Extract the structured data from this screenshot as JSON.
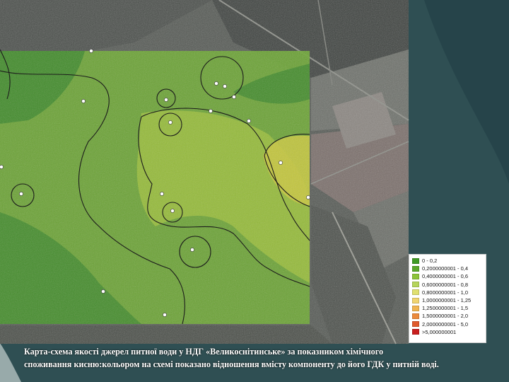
{
  "legend": {
    "items": [
      {
        "label": "0 - 0,2",
        "color": "#3f9a25"
      },
      {
        "label": "0,2000000001 - 0,4",
        "color": "#5aa82a"
      },
      {
        "label": "0,4000000001 - 0,6",
        "color": "#8cc43a"
      },
      {
        "label": "0,6000000001 - 0,8",
        "color": "#b6d55a"
      },
      {
        "label": "0,8000000001 - 1,0",
        "color": "#e0e070"
      },
      {
        "label": "1,0000000001 - 1,25",
        "color": "#f0d470"
      },
      {
        "label": "1,2500000001 - 1,5",
        "color": "#f0b450"
      },
      {
        "label": "1,5000000001 - 2,0",
        "color": "#ec8a3c"
      },
      {
        "label": "2,0000000001 - 5,0",
        "color": "#e05a2c"
      },
      {
        "label": ">5,000000001",
        "color": "#c81e1e"
      }
    ]
  },
  "caption": {
    "line1": "Карта-схема якості джерел питної води у НДГ «Великоснітинське» за показником хімічного",
    "line2": "споживання кисню:кольором на схемі показано відношення вмісту компоненту до його ГДК у питній воді."
  },
  "colors": {
    "background": "#2f4f53",
    "satellite": "#565a54",
    "map_zone_main": "#6da832",
    "map_zone_light": "#9cc03a",
    "map_zone_yellow": "#c8c83c",
    "map_zone_dark": "#3e8a2a",
    "isoline": "#1c1c1c",
    "well_marker": "#ffffff"
  }
}
